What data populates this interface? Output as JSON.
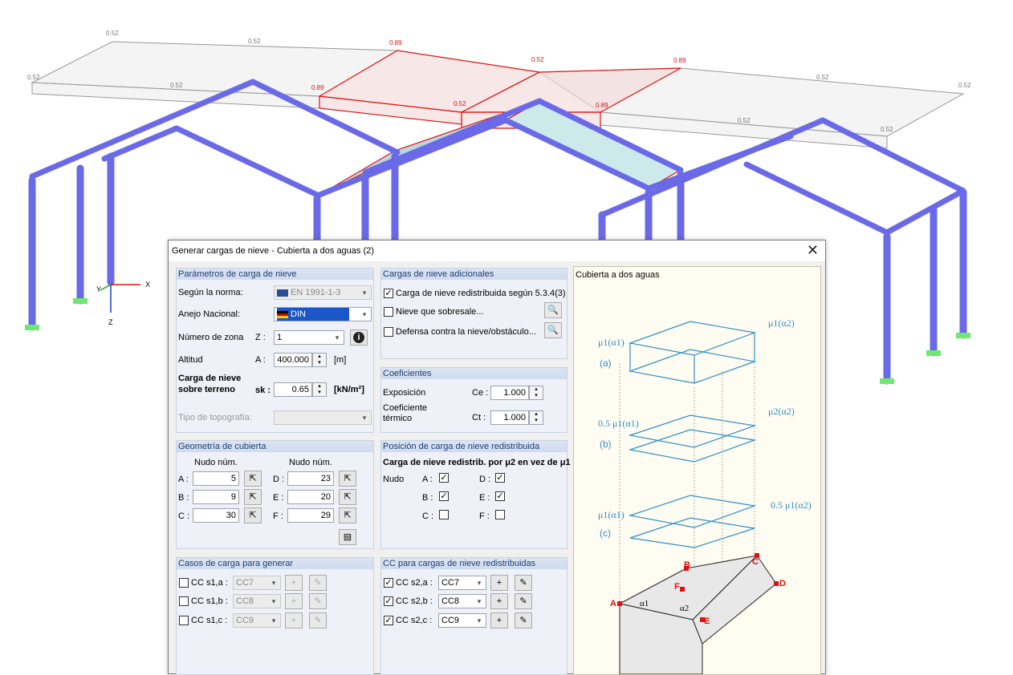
{
  "scene": {
    "load_values": [
      "0.52",
      "0.52",
      "0.89",
      "0.52",
      "0.89",
      "0.52",
      "0.52",
      "0.89",
      "0.52",
      "0.89",
      "0.52",
      "0.52",
      "0.52",
      "0.52"
    ],
    "axis_x": "X",
    "axis_y": "Y",
    "axis_z": "Z"
  },
  "dialog": {
    "title": "Generar cargas de nieve - Cubierta a dos aguas  (2)",
    "close": "✕"
  },
  "params": {
    "header": "Parámetros de carga de nieve",
    "norm_label": "Según la norma:",
    "norm_value": "EN 1991-1-3",
    "annex_label": "Anejo Nacional:",
    "annex_value": "DIN",
    "zone_label": "Número de zona",
    "zone_sym": "Z :",
    "zone_value": "1",
    "alt_label": "Altitud",
    "alt_sym": "A :",
    "alt_value": "400.000",
    "alt_unit": "[m]",
    "snow_label1": "Carga de nieve",
    "snow_label2": "sobre terreno",
    "snow_sym": "sk :",
    "snow_value": "0.65",
    "snow_unit": "[kN/m²]",
    "topo_label": "Tipo de topografía:"
  },
  "additional": {
    "header": "Cargas de nieve adicionales",
    "redistributed": "Carga de nieve redistribuida según 5.3.4(3)",
    "overhang": "Nieve que sobresale...",
    "guard": "Defensa contra la nieve/obstáculo..."
  },
  "coef": {
    "header": "Coeficientes",
    "exp_label": "Exposición",
    "exp_sym": "Ce :",
    "exp_value": "1.000",
    "th_label1": "Coeficiente",
    "th_label2": "térmico",
    "th_sym": "Ct :",
    "th_value": "1.000"
  },
  "geom": {
    "header": "Geometría de cubierta",
    "node_hdr1": "Nudo núm.",
    "node_hdr2": "Nudo núm.",
    "a_label": "A :",
    "a_value": "5",
    "b_label": "B :",
    "b_value": "9",
    "c_label": "C :",
    "c_value": "30",
    "d_label": "D :",
    "d_value": "23",
    "e_label": "E :",
    "e_value": "20",
    "f_label": "F :",
    "f_value": "29"
  },
  "position": {
    "header": "Posición de carga de nieve redistribuida",
    "subtitle": "Carga de nieve redistrib. por μ2 en vez de μ1",
    "node": "Nudo",
    "a": "A :",
    "b": "B :",
    "c": "C :",
    "d": "D :",
    "e": "E :",
    "f": "F :"
  },
  "cases": {
    "header": "Casos de carga para generar",
    "s1a": "CC s1,a :",
    "s1a_val": "CC7",
    "s1b": "CC s1,b :",
    "s1b_val": "CC8",
    "s1c": "CC s1,c :",
    "s1c_val": "CC9"
  },
  "cc_redis": {
    "header": "CC para cargas de nieve redistribuidas",
    "s2a": "CC s2,a :",
    "s2a_val": "CC7",
    "s2b": "CC s2,b :",
    "s2b_val": "CC8",
    "s2c": "CC s2,c :",
    "s2c_val": "CC9"
  },
  "picture": {
    "title": "Cubierta a dos aguas",
    "mu1a1": "μ1(α1)",
    "mu1a2": "μ1(α2)",
    "case_a": "(a)",
    "half_mu1a1": "0.5 μ1(α1)",
    "mu2a2": "μ2(α2)",
    "case_b": "(b)",
    "mu1a1_c": "μ1(α1)",
    "half_mu1a2": "0.5 μ1(α2)",
    "case_c": "(c)",
    "pA": "A",
    "pB": "B",
    "pC": "C",
    "pD": "D",
    "pE": "E",
    "pF": "F",
    "alpha1": "α1",
    "alpha2": "α2"
  },
  "colors": {
    "beam": "#6a6ae8",
    "accent": "#2e8fc8",
    "red": "#e01010"
  }
}
